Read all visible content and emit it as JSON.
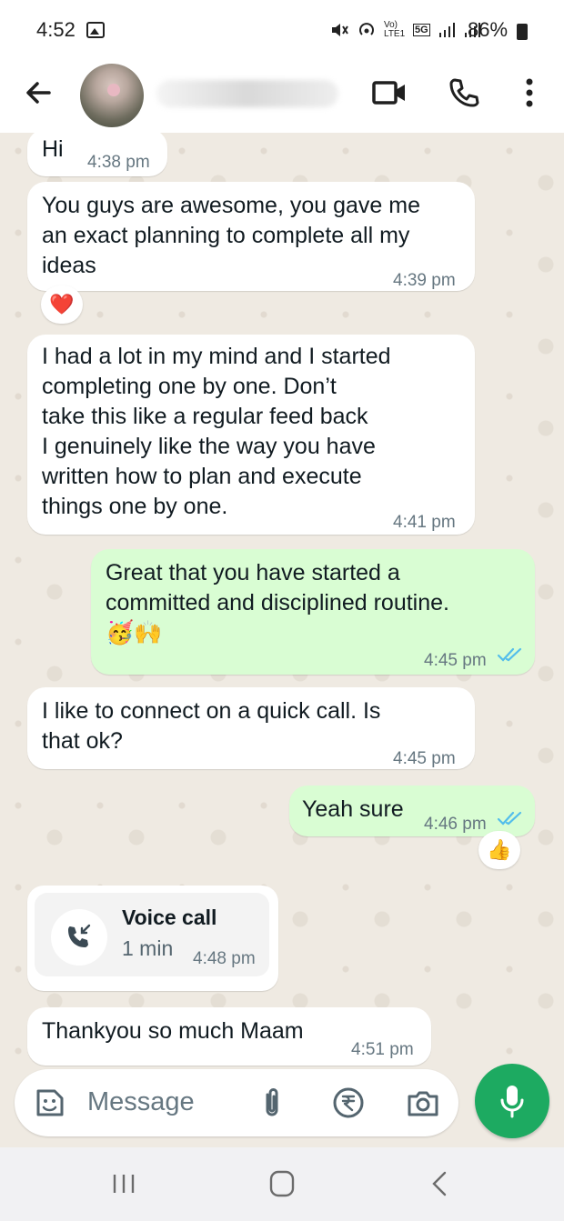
{
  "status_bar": {
    "time": "4:52",
    "signal_text": "Vo) LTE1",
    "network": "5G",
    "battery": "86%"
  },
  "header": {
    "contact_name": "",
    "avatar_icon": "profile-photo-flower",
    "video_icon": "video-camera-icon",
    "phone_icon": "phone-icon",
    "menu_icon": "more-vert-icon"
  },
  "messages": [
    {
      "dir": "in",
      "text": "Hi",
      "time": "4:38 pm"
    },
    {
      "dir": "in",
      "text": "You guys are awesome, you gave me\nan exact planning to complete all my\nideas",
      "time": "4:39 pm",
      "reaction": "❤️"
    },
    {
      "dir": "in",
      "text": "I had a lot in my mind and I started\ncompleting one by one. Don’t\ntake this like a regular feed back\nI genuinely like the way you have\nwritten how to plan and execute\nthings one by one.",
      "time": "4:41 pm"
    },
    {
      "dir": "out",
      "text": "Great that you have started a\ncommitted and disciplined routine.\n🥳🙌",
      "time": "4:45 pm",
      "read": true
    },
    {
      "dir": "in",
      "text": "I like to connect on a quick call. Is\nthat ok?",
      "time": "4:45 pm"
    },
    {
      "dir": "out",
      "text": "Yeah sure",
      "time": "4:46 pm",
      "read": true,
      "reaction": "👍"
    },
    {
      "dir": "in",
      "type": "call",
      "title": "Voice call",
      "duration": "1 min",
      "time": "4:48 pm"
    },
    {
      "dir": "in",
      "text": "Thankyou so much Maam",
      "time": "4:51 pm"
    }
  ],
  "input": {
    "placeholder": "Message",
    "icons": [
      "sticker-icon",
      "attach-icon",
      "rupee-payment-icon",
      "camera-icon",
      "mic-icon"
    ]
  },
  "colors": {
    "incoming": "#ffffff",
    "outgoing": "#d9fdd3",
    "accent": "#1daa61",
    "read_tick": "#53bdeb",
    "timestamp": "#667781"
  }
}
